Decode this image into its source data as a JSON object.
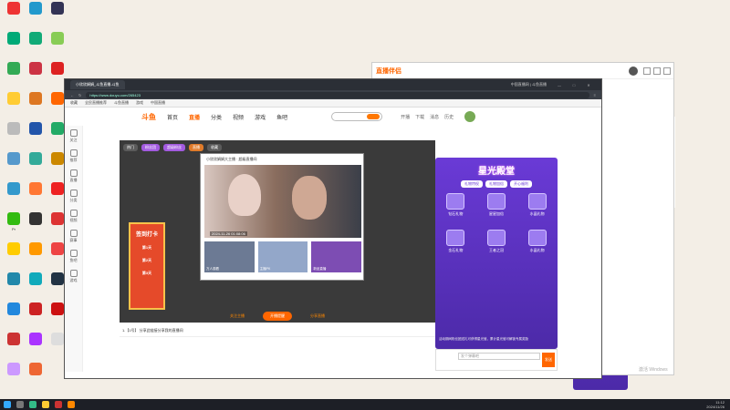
{
  "desktop": {
    "icons": [
      {
        "label": "",
        "color": "#e33"
      },
      {
        "label": "",
        "color": "#0a7"
      },
      {
        "label": "",
        "color": "#3a5"
      },
      {
        "label": "",
        "color": "#fc3"
      },
      {
        "label": "",
        "color": "#bbb"
      },
      {
        "label": "",
        "color": "#59c"
      },
      {
        "label": "",
        "color": "#39c"
      },
      {
        "label": "Pr",
        "color": "#3b1"
      },
      {
        "label": "",
        "color": "#fc0"
      },
      {
        "label": "",
        "color": "#28a"
      },
      {
        "label": "",
        "color": "#28d"
      },
      {
        "label": "",
        "color": "#c33"
      },
      {
        "label": "",
        "color": "#c9f"
      },
      {
        "label": "",
        "color": "#29c"
      },
      {
        "label": "",
        "color": "#1a7"
      },
      {
        "label": "",
        "color": "#c34"
      },
      {
        "label": "",
        "color": "#d72"
      },
      {
        "label": "",
        "color": "#25a"
      },
      {
        "label": "",
        "color": "#3a9"
      },
      {
        "label": "",
        "color": "#f73"
      },
      {
        "label": "",
        "color": "#333"
      },
      {
        "label": "",
        "color": "#f90"
      },
      {
        "label": "",
        "color": "#1ab"
      },
      {
        "label": "",
        "color": "#c22"
      },
      {
        "label": "",
        "color": "#a3f"
      },
      {
        "label": "",
        "color": "#e63"
      },
      {
        "label": "",
        "color": "#335"
      },
      {
        "label": "",
        "color": "#8c5"
      },
      {
        "label": "",
        "color": "#d22"
      },
      {
        "label": "",
        "color": "#f60"
      },
      {
        "label": "",
        "color": "#2a6"
      },
      {
        "label": "",
        "color": "#c80"
      },
      {
        "label": "",
        "color": "#e22"
      },
      {
        "label": "",
        "color": "#d33"
      },
      {
        "label": "",
        "color": "#e44"
      },
      {
        "label": "",
        "color": "#234"
      },
      {
        "label": "",
        "color": "#c11"
      },
      {
        "label": "",
        "color": "#ddd"
      }
    ]
  },
  "bg_window": {
    "logo": "直播伴侣"
  },
  "browser": {
    "tabs": [
      "小欣欣娟娟_斗鱼直播-斗鱼",
      "中国直播网 | 斗鱼直播"
    ],
    "url": "https://www.douyu.com/265423",
    "bookmarks": [
      "收藏",
      "全民直播推荐",
      "斗鱼直播",
      "游戏",
      "中国直播"
    ]
  },
  "site": {
    "brand": "斗鱼",
    "nav": [
      "首页",
      "直播",
      "分类",
      "视频",
      "游戏",
      "鱼吧"
    ],
    "nav_active": 1,
    "header_icons": [
      "开播",
      "下载",
      "消息",
      "历史"
    ]
  },
  "sidebar": [
    "关注",
    "推荐",
    "直播",
    "分类",
    "视频",
    "赛事",
    "鱼吧",
    "游戏"
  ],
  "player": {
    "tags": [
      "热门",
      "粉丝团",
      "超级粉丝",
      "直播",
      "收藏"
    ],
    "title": "小欣欣娟娟大主播 · 超级直播间",
    "timestamp": "2024-11-26 01:08:06",
    "thumbs": [
      "万人观看",
      "主播PK",
      "新品直播"
    ],
    "banner_title": "签到打卡",
    "banner_days": [
      "第1天",
      "第2天",
      "第3天"
    ],
    "controls": [
      "关注主播",
      "开播提醒",
      "分享直播"
    ]
  },
  "gift": {
    "title": "星光殿堂",
    "tabs": [
      "礼物特权",
      "礼物加倍",
      "开心福利"
    ],
    "items_row1": [
      "钻石礼物",
      "星星加倍",
      "水晶礼物"
    ],
    "items_row2": [
      "金石礼物",
      "王者之冠",
      "水晶礼物"
    ],
    "desc": "活动期间粉丝团送礼可获得星光值，累计星光值可解锁专属奖励"
  },
  "chat": {
    "placeholder": "发个弹幕吧",
    "send": "发送"
  },
  "below": {
    "line1": "1.【1号】 分享此链接分享我的直播间"
  },
  "taskbar": {
    "time": "11:12",
    "date": "2024/11/26"
  },
  "watermark": "激活 Windows"
}
